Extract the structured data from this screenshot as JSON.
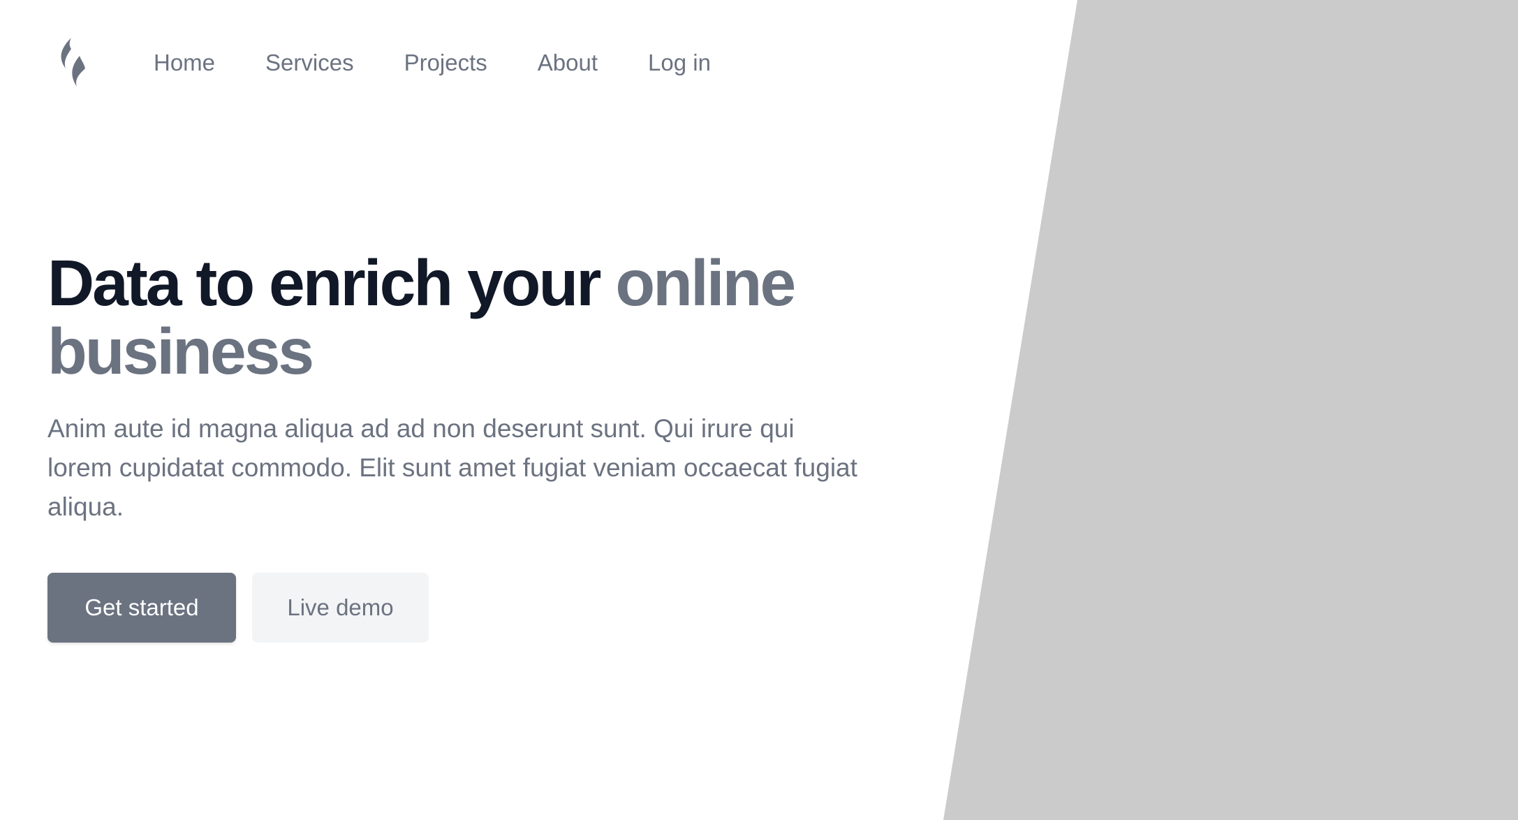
{
  "nav": {
    "logo_icon": "flame-icon",
    "items": [
      {
        "label": "Home"
      },
      {
        "label": "Services"
      },
      {
        "label": "Projects"
      },
      {
        "label": "About"
      },
      {
        "label": "Log in"
      }
    ]
  },
  "hero": {
    "headline_main": "Data to enrich your",
    "headline_accent": "online business",
    "description": "Anim aute id magna aliqua ad ad non deserunt sunt. Qui irure qui lorem cupidatat commodo. Elit sunt amet fugiat veniam occaecat fugiat aliqua.",
    "primary_button": "Get started",
    "secondary_button": "Live demo"
  },
  "colors": {
    "heading": "#111827",
    "accent": "#6b7280",
    "image_placeholder": "#cbcbcb"
  }
}
